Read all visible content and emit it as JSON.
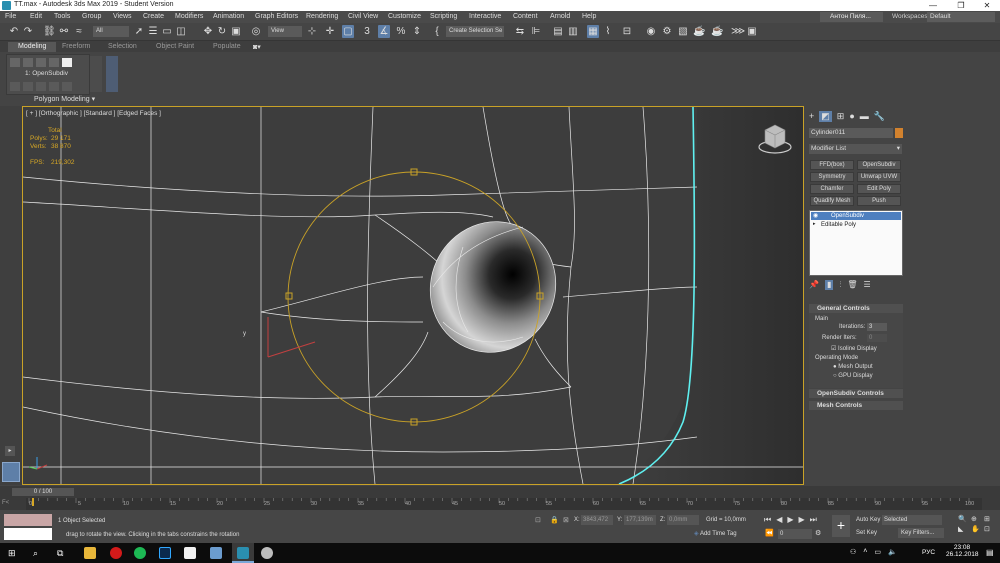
{
  "window": {
    "title": "TT.max - Autodesk 3ds Max 2019 - Student Version"
  },
  "menus": [
    "File",
    "Edit",
    "Tools",
    "Group",
    "Views",
    "Create",
    "Modifiers",
    "Animation",
    "Graph Editors",
    "Rendering",
    "Civil View",
    "Customize",
    "Scripting",
    "Interactive",
    "Content",
    "Arnold",
    "Help"
  ],
  "user": {
    "name": "Антон Пиля..."
  },
  "workspaces": {
    "label": "Workspaces:",
    "value": "Default"
  },
  "toolbar": {
    "filter": "All",
    "refcoord": "View",
    "selset": "Create Selection Se"
  },
  "ribbon": {
    "tabs": [
      "Modeling",
      "Freeform",
      "Selection",
      "Object Paint",
      "Populate"
    ],
    "active_tab": "Modeling",
    "modifier_label": "1: OpenSubdiv",
    "panel_label": "Polygon Modeling"
  },
  "viewport": {
    "label": "[ + ] [Orthographic ] [Standard ] [Edged Faces ]",
    "stats": {
      "total_label": "Total",
      "polys_label": "Polys:",
      "polys": "29 171",
      "verts_label": "Verts:",
      "verts": "38 870",
      "fps_label": "FPS:",
      "fps": "219,302"
    }
  },
  "command_panel": {
    "object_name": "Cylinder011",
    "modifier_list": "Modifier List",
    "modifier_buttons": [
      "FFD(box)",
      "OpenSubdiv",
      "Symmetry",
      "Unwrap UVW",
      "Chamfer",
      "Edit Poly",
      "Quadify Mesh",
      "Push"
    ],
    "stack": [
      "OpenSubdiv",
      "Editable Poly"
    ],
    "general_controls": {
      "title": "General Controls",
      "main_label": "Main",
      "iterations_label": "Iterations:",
      "iterations": "3",
      "render_iters_label": "Render Iters:",
      "render_iters": "0",
      "isoline_label": "Isoline Display",
      "operating_mode_label": "Operating Mode",
      "mesh_output": "Mesh Output",
      "gpu_display": "GPU Display"
    },
    "rollups": [
      "OpenSubdiv Controls",
      "Mesh Controls"
    ]
  },
  "timeline": {
    "frame": "0 / 100",
    "ticks": [
      "0",
      "5",
      "10",
      "15",
      "20",
      "25",
      "30",
      "35",
      "40",
      "45",
      "50",
      "55",
      "60",
      "65",
      "70",
      "75",
      "80",
      "85",
      "90",
      "95",
      "100"
    ]
  },
  "status": {
    "selected": "1 Object Selected",
    "prompt": "drag to rotate the view.  Clicking in the tabs constrains the rotation",
    "x_label": "X:",
    "x": "3843,472",
    "y_label": "Y:",
    "y": "177,139m",
    "z_label": "Z:",
    "z": "0,0mm",
    "grid": "Grid = 10,0mm",
    "add_time_tag": "Add Time Tag",
    "auto_key": "Auto Key",
    "set_key": "Set Key",
    "selected_dd": "Selected",
    "key_filters": "Key Filters...",
    "frame": "0"
  },
  "taskbar": {
    "lang": "РУС",
    "time": "23:08",
    "date": "26.12.2018"
  },
  "colors": {
    "accent": "#5e7fa8",
    "viewport_border": "#c9a227",
    "gizmo": "#d8a825",
    "highlight_edge": "#5ff0f0"
  }
}
